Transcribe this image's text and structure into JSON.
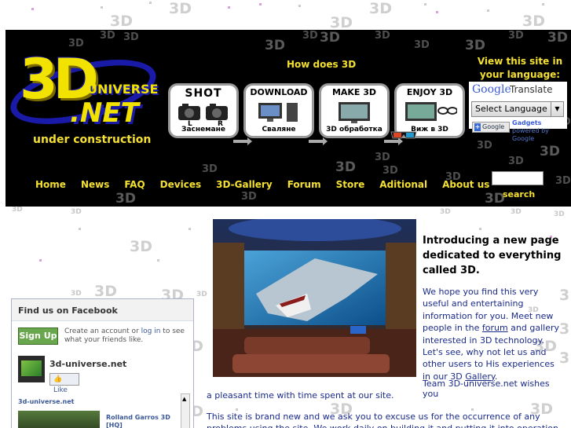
{
  "watermark_text": "3D",
  "header": {
    "logo": {
      "big": "3D",
      "word1": "UNIVERSE",
      "word2": ".NET"
    },
    "how_text": "How does 3D",
    "under_construction": "under construction",
    "view_site": "View this site in your language:",
    "steps": [
      {
        "title": "SHOT",
        "sub1": "L",
        "sub2": "R",
        "caption": "Заснемане"
      },
      {
        "title": "DOWNLOAD",
        "caption": "Сваляне"
      },
      {
        "title": "MAKE 3D",
        "caption": "3D обработка"
      },
      {
        "title": "ENJOY 3D",
        "caption": "Виж в 3D"
      }
    ],
    "translate": {
      "google": "Google",
      "translate": "Translate",
      "select_label": "Select Language",
      "gadgets_text": "Gadgets",
      "powered_by": "powered by Google",
      "add_button": "Google"
    },
    "nav": [
      "Home",
      "News",
      "FAQ",
      "Devices",
      "3D-Gallery",
      "Forum",
      "Store",
      "Aditional",
      "About us"
    ],
    "search_label": "search"
  },
  "facebook": {
    "title": "Find us on Facebook",
    "signup": "Sign Up",
    "text_pre": "Create an account or ",
    "login": "log in",
    "text_post": " to see what your friends like.",
    "page_name": "3d-universe.net",
    "like": "Like",
    "subhead": "3d-universe.net",
    "video_title": "Rolland Garros 3D [HQ]"
  },
  "intro": {
    "title": "Introducing a new page dedicated to everything called 3D.",
    "body_1": "We hope you find this very useful and entertaining information for you. Meet new people in the ",
    "forum_link": "forum",
    "body_2": " and gallery interested in 3D technology. Let's see, why not let us and other users to His experiences in our 3D ",
    "gallery_link": "Gallery",
    "body_3": ".",
    "team": "Team 3D-universe.net wishes you",
    "pleasant": "a pleasant time with time spent at our site.",
    "newsite": "This site is brand new and we ask you to excuse us for the occurrence of any problems using the site. We work daily on building it and putting it into operation."
  },
  "colors": {
    "header_bg": "#000000",
    "accent_yellow": "#f4e033",
    "link_blue": "#1a2a8a"
  }
}
